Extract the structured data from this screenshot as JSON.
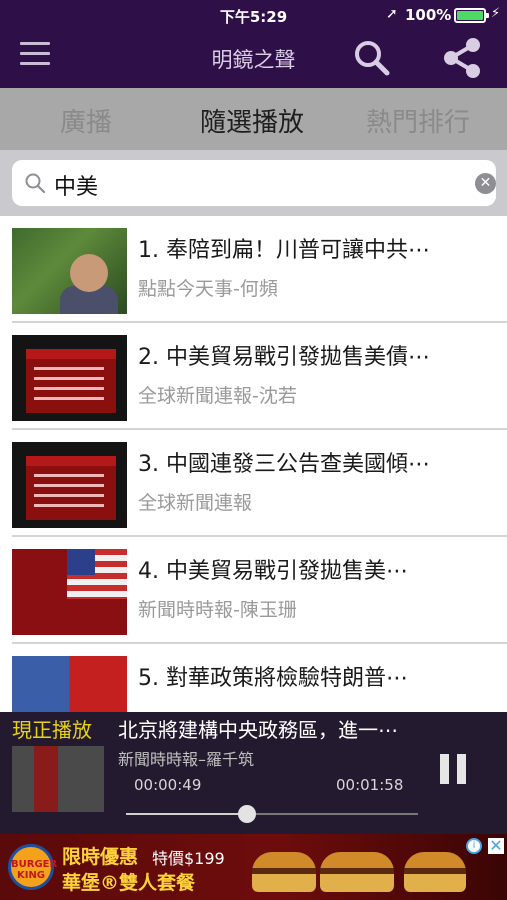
{
  "status_bar": {
    "time": "下午5:29",
    "battery": "100%",
    "location_icon": "location-arrow-icon",
    "battery_icon": "battery-full-icon",
    "charging_icon": "bolt-icon"
  },
  "header": {
    "title": "明鏡之聲",
    "menu_icon": "hamburger-menu-icon",
    "search_icon": "search-icon",
    "share_icon": "share-icon",
    "bg_color": "#2f0f48"
  },
  "tabs": [
    {
      "label": "廣播",
      "active": false
    },
    {
      "label": "隨選播放",
      "active": true
    },
    {
      "label": "熱門排行",
      "active": false
    }
  ],
  "search": {
    "value": "中美",
    "icon": "magnifier-icon",
    "clear_icon": "clear-icon"
  },
  "results": [
    {
      "title": "1. 奉陪到扁！川普可讓中共⋯",
      "subtitle": "點點今天事-何頻"
    },
    {
      "title": "2. 中美貿易戰引發拋售美債⋯",
      "subtitle": "全球新聞連報-沈若"
    },
    {
      "title": "3. 中國連發三公告查美國傾⋯",
      "subtitle": "全球新聞連報"
    },
    {
      "title": "4. 中美貿易戰引發拋售美⋯",
      "subtitle": "新聞時時報-陳玉珊"
    },
    {
      "title": "5. 對華政策將檢驗特朗普⋯",
      "subtitle": ""
    }
  ],
  "player": {
    "now_label": "現正播放",
    "title": "北京將建構中央政務區，進一⋯",
    "subtitle": "新聞時時報–羅千筑",
    "current_time": "00:00:49",
    "duration": "00:01:58",
    "progress": 0.415,
    "pause_icon": "pause-icon",
    "accent_color": "#e7d21a"
  },
  "ad": {
    "brand_logo": "BURGER KING",
    "line1": "限時優惠",
    "price": "特價$199",
    "line2": "華堡®雙人套餐",
    "info_icon": "ad-info-icon",
    "close_icon": "ad-close-icon"
  }
}
